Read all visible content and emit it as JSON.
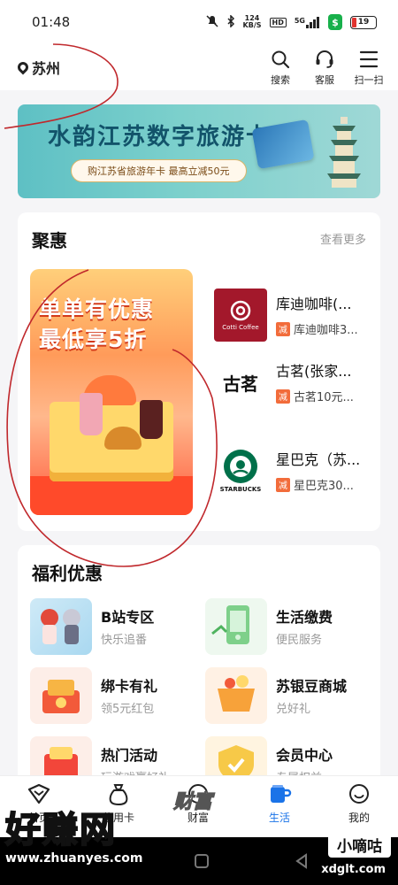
{
  "status_bar": {
    "time": "01:48",
    "net_speed_value": "124",
    "net_speed_unit": "KB/S",
    "hd": "HD",
    "net": "5G",
    "battery": "19"
  },
  "header": {
    "location": "苏州",
    "buttons": [
      {
        "label": "搜索"
      },
      {
        "label": "客服"
      },
      {
        "label": "扫一扫"
      }
    ]
  },
  "banner": {
    "title": "水韵江苏数字旅游卡",
    "subtitle": "购江苏省旅游年卡 最高立减50元"
  },
  "juhui": {
    "title": "聚惠",
    "more": "查看更多",
    "promo": {
      "line1": "单单有优惠",
      "line2": "最低享5折"
    },
    "stores": [
      {
        "name": "库迪咖啡(...",
        "tag": "减",
        "deal": "库迪咖啡3...",
        "logo_text": "Cotti Coffee",
        "logo_color": "#a3182b"
      },
      {
        "name": "古茗(张家...",
        "tag": "减",
        "deal": "古茗10元...",
        "logo_text": "古茗"
      },
      {
        "name": "星巴克（苏...",
        "tag": "减",
        "deal": "星巴克30...",
        "logo_text": "STARBUCKS",
        "logo_color": "#00704a"
      }
    ]
  },
  "fuli": {
    "title": "福利优惠",
    "items": [
      {
        "title": "B站专区",
        "sub": "快乐追番"
      },
      {
        "title": "生活缴费",
        "sub": "便民服务"
      },
      {
        "title": "绑卡有礼",
        "sub": "领5元红包"
      },
      {
        "title": "苏银豆商城",
        "sub": "兑好礼"
      },
      {
        "title": "热门活动",
        "sub": "玩游戏赢好礼"
      },
      {
        "title": "会员中心",
        "sub": "专属权益"
      }
    ]
  },
  "nav": {
    "items": [
      {
        "label": "首页"
      },
      {
        "label": "信用卡"
      },
      {
        "label": "财富"
      },
      {
        "label": "生活"
      },
      {
        "label": "我的"
      }
    ],
    "active": "生活",
    "accent": "#1a73e8"
  },
  "watermarks": {
    "big": "好赚网",
    "url": "www.zhuanyes.com",
    "badge": "小嘀咕",
    "site2": "xdglt.com",
    "caifu": "财富"
  }
}
